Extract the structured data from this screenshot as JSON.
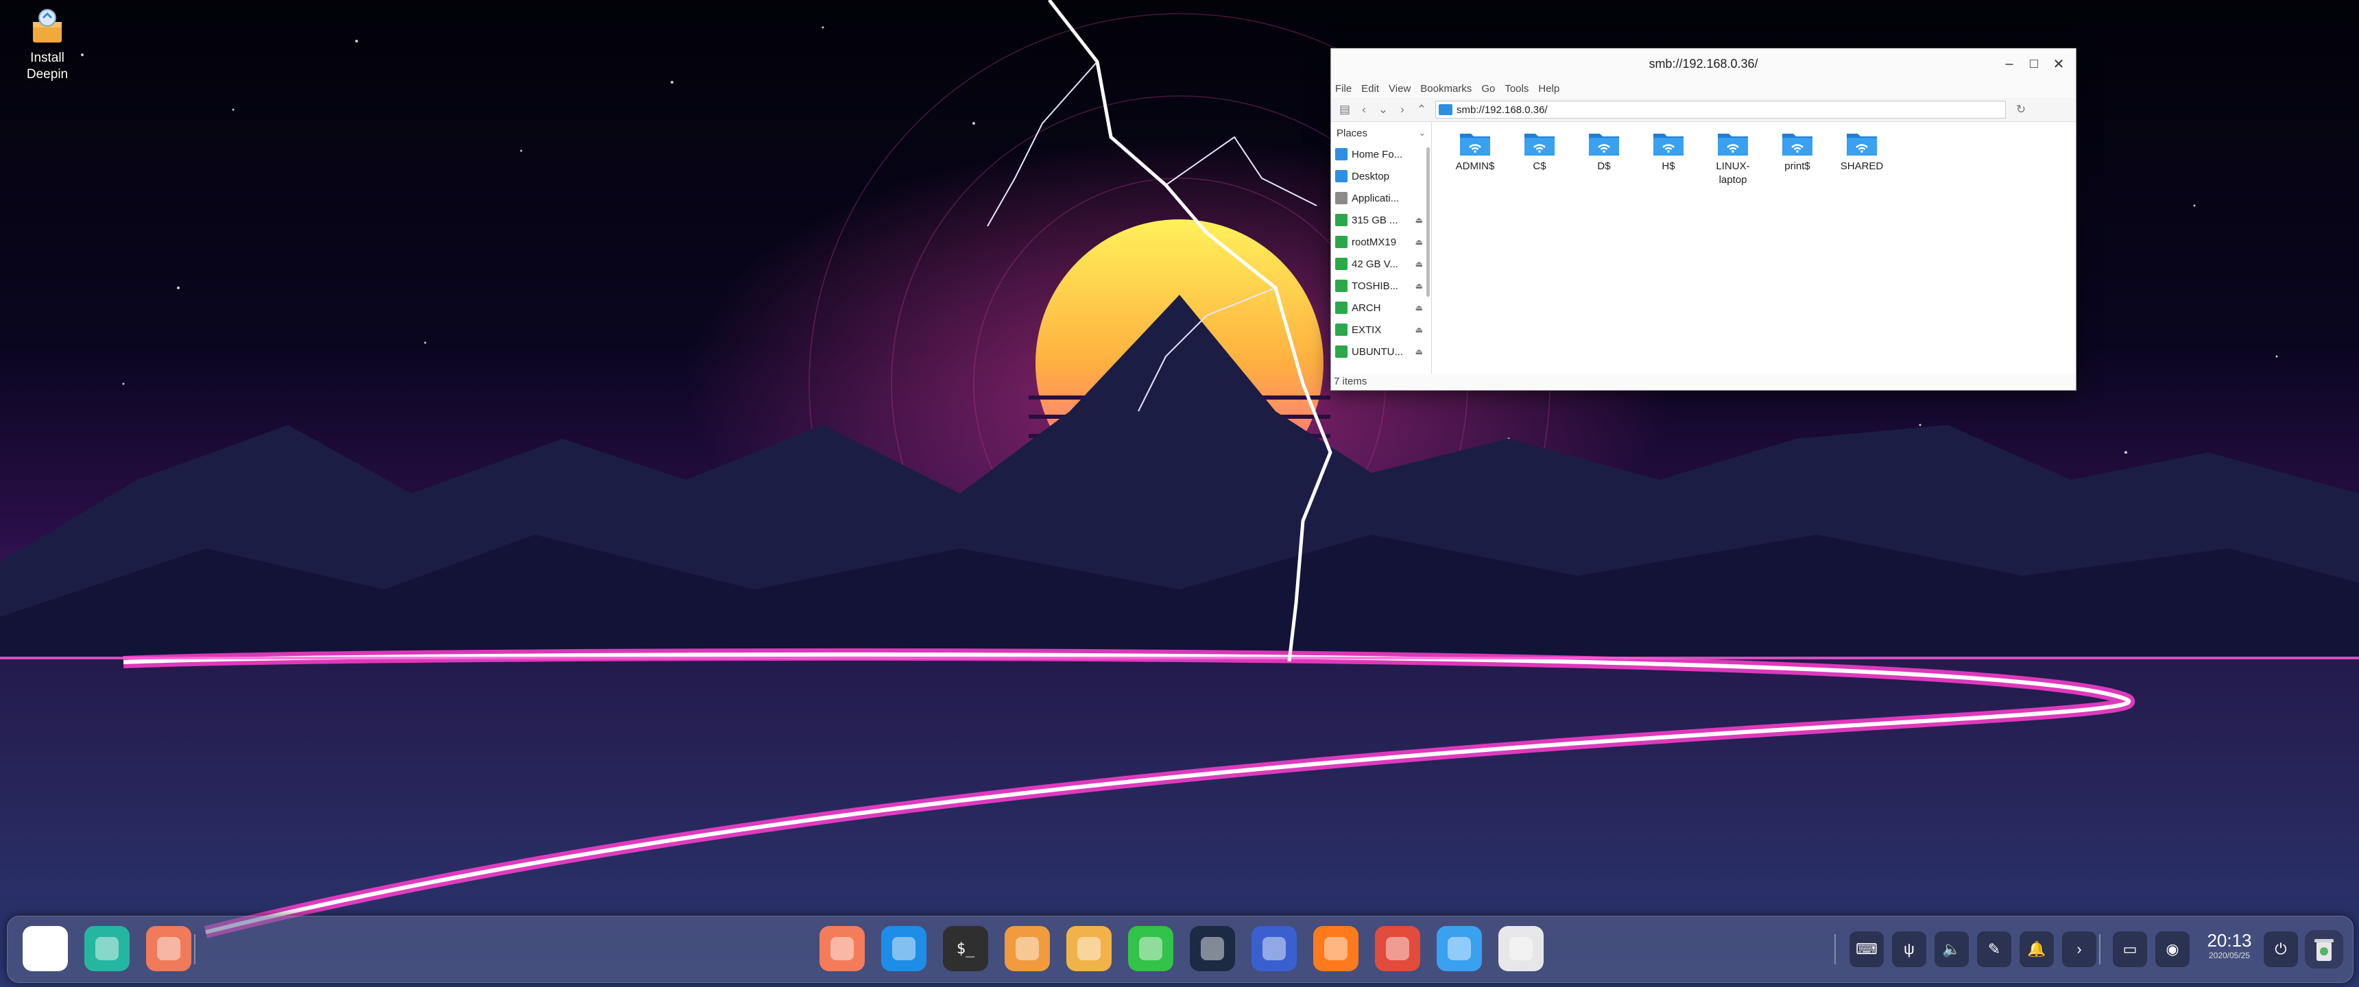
{
  "desktop": {
    "icons": [
      {
        "label": "Install Deepin",
        "icon": "package-icon"
      }
    ]
  },
  "window": {
    "title": "smb://192.168.0.36/",
    "controls": {
      "minimize": "–",
      "maximize": "□",
      "close": "✕"
    },
    "menu": [
      "File",
      "Edit",
      "View",
      "Bookmarks",
      "Go",
      "Tools",
      "Help"
    ],
    "location": "smb://192.168.0.36/",
    "sidebar": {
      "header": "Places",
      "items": [
        {
          "label": "Home Fo...",
          "icon": "home-folder-icon",
          "color": "#2d8fe4",
          "eject": false
        },
        {
          "label": "Desktop",
          "icon": "desktop-folder-icon",
          "color": "#2d8fe4",
          "eject": false
        },
        {
          "label": "Applicati...",
          "icon": "applications-icon",
          "color": "#8a8a8a",
          "eject": false
        },
        {
          "label": "315 GB ...",
          "icon": "drive-icon",
          "color": "#2aa84a",
          "eject": true
        },
        {
          "label": "rootMX19",
          "icon": "drive-icon",
          "color": "#2aa84a",
          "eject": true
        },
        {
          "label": "42 GB V...",
          "icon": "drive-icon",
          "color": "#2aa84a",
          "eject": true
        },
        {
          "label": "TOSHIB...",
          "icon": "drive-icon",
          "color": "#2aa84a",
          "eject": true
        },
        {
          "label": "ARCH",
          "icon": "drive-icon",
          "color": "#2aa84a",
          "eject": true
        },
        {
          "label": "EXTIX",
          "icon": "drive-icon",
          "color": "#2aa84a",
          "eject": true
        },
        {
          "label": "UBUNTU...",
          "icon": "drive-icon",
          "color": "#2aa84a",
          "eject": true
        }
      ],
      "eject_glyph": "⏏"
    },
    "files": [
      {
        "label": "ADMIN$"
      },
      {
        "label": "C$"
      },
      {
        "label": "D$"
      },
      {
        "label": "H$"
      },
      {
        "label": "LINUX-\nlaptop"
      },
      {
        "label": "print$"
      },
      {
        "label": "SHARED"
      }
    ],
    "status": "7 items"
  },
  "dock": {
    "left": [
      {
        "name": "launcher-icon",
        "color": "#ffffff"
      },
      {
        "name": "multitasking-view-icon",
        "color": "#25b6a0"
      },
      {
        "name": "show-desktop-icon",
        "color": "#f07a5a"
      }
    ],
    "apps": [
      {
        "name": "launcher-grid-icon",
        "color": "#f47c5b"
      },
      {
        "name": "app-store-icon",
        "color": "#1e8de8"
      },
      {
        "name": "terminal-icon",
        "color": "#2f2f2f",
        "glyph": "$_"
      },
      {
        "name": "archive-manager-icon",
        "color": "#f19a3e"
      },
      {
        "name": "downloader-icon",
        "color": "#f2b24a"
      },
      {
        "name": "music-icon",
        "color": "#33c24a"
      },
      {
        "name": "video-player-icon",
        "color": "#1c2a44"
      },
      {
        "name": "settings-icon",
        "color": "#3a5fcf"
      },
      {
        "name": "firefox-icon",
        "color": "#ff7a1a"
      },
      {
        "name": "system-tools-icon",
        "color": "#e34b3b"
      },
      {
        "name": "file-manager-icon",
        "color": "#3aa0f0"
      },
      {
        "name": "camera-icon",
        "color": "#e7e7ea"
      }
    ],
    "tray": [
      {
        "name": "keyboard-icon",
        "glyph": "⌨"
      },
      {
        "name": "usb-icon",
        "glyph": "ψ"
      },
      {
        "name": "volume-icon",
        "glyph": "🔈"
      },
      {
        "name": "pen-icon",
        "glyph": "✎"
      },
      {
        "name": "notification-icon",
        "glyph": "🔔"
      },
      {
        "name": "expand-arrow-icon",
        "glyph": "›"
      }
    ],
    "tray2": [
      {
        "name": "screen-icon",
        "glyph": "▭"
      },
      {
        "name": "network-icon",
        "glyph": "◉"
      }
    ],
    "time": "20:13",
    "date": "2020/05/25",
    "power_glyph": "⏻"
  }
}
